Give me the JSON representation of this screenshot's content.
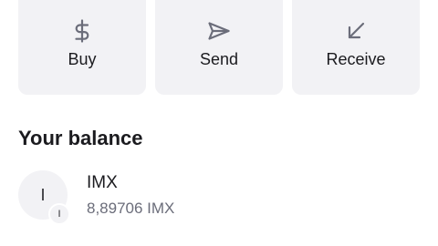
{
  "actions": [
    {
      "label": "Buy",
      "icon": "dollar-icon"
    },
    {
      "label": "Send",
      "icon": "send-arrow-icon"
    },
    {
      "label": "Receive",
      "icon": "arrow-down-left-icon"
    }
  ],
  "balance": {
    "title": "Your balance",
    "assets": [
      {
        "avatar_letter": "I",
        "badge_letter": "I",
        "symbol": "IMX",
        "amount": "8,89706 IMX"
      }
    ]
  },
  "colors": {
    "card_bg": "#f2f2f5",
    "icon": "#6b6d7a",
    "text_primary": "#1b1b1f",
    "text_secondary": "#6b6d7a"
  }
}
